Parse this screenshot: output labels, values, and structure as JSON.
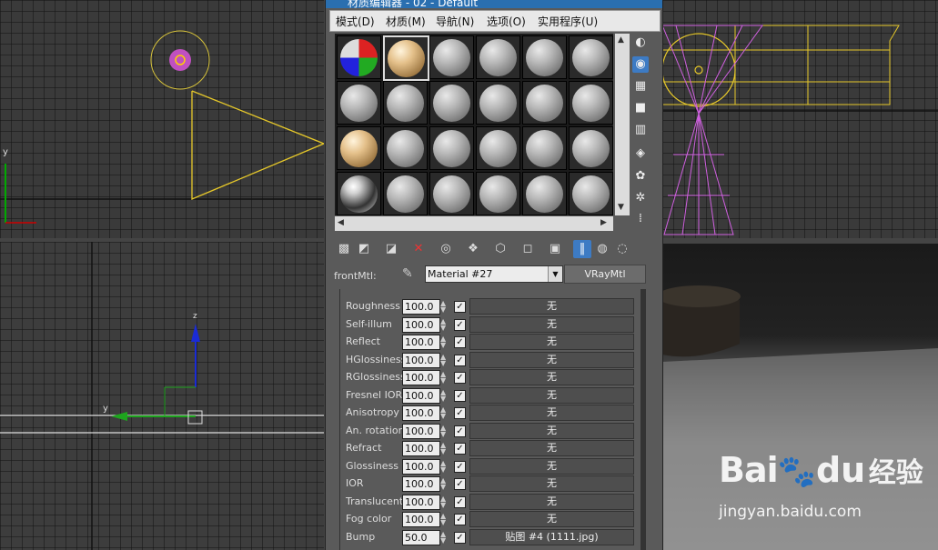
{
  "window": {
    "title": "材质编辑器 - 02 - Default"
  },
  "menu": [
    "模式(D)",
    "材质(M)",
    "导航(N)",
    "选项(O)",
    "实用程序(U)"
  ],
  "viewports": {
    "left_axis": "y",
    "front_axis_z": "z",
    "front_axis_y": "y"
  },
  "slots": {
    "rows": [
      [
        "checker",
        "tan-selected",
        "gray",
        "gray",
        "gray",
        "gray"
      ],
      [
        "gray",
        "gray",
        "gray",
        "gray",
        "gray",
        "gray"
      ],
      [
        "tan",
        "gray",
        "gray",
        "gray",
        "gray",
        "gray"
      ],
      [
        "chrome",
        "gray",
        "gray",
        "gray",
        "gray",
        "gray"
      ]
    ]
  },
  "side_tools": [
    "sample-type-icon",
    "backlight-icon",
    "background-icon",
    "uv-tiling-icon",
    "video-color-icon",
    "make-preview-icon",
    "options-icon",
    "select-by-material-icon",
    "material-navigator-icon"
  ],
  "toolbar": [
    "get-material-icon",
    "put-to-scene-icon",
    "assign-to-selection-icon",
    "reset-map-icon",
    "make-copy-icon",
    "make-unique-icon",
    "put-to-library-icon",
    "material-id-icon",
    "show-shaded-icon",
    "show-end-result-icon",
    "go-to-parent-icon",
    "go-forward-icon"
  ],
  "material": {
    "slot_label": "frontMtl:",
    "name": "Material #27",
    "type": "VRayMtl"
  },
  "params": [
    {
      "label": "Roughness",
      "value": "100.0",
      "map": "无"
    },
    {
      "label": "Self-illum",
      "value": "100.0",
      "map": "无"
    },
    {
      "label": "Reflect",
      "value": "100.0",
      "map": "无"
    },
    {
      "label": "HGlossiness",
      "value": "100.0",
      "map": "无"
    },
    {
      "label": "RGlossiness",
      "value": "100.0",
      "map": "无"
    },
    {
      "label": "Fresnel IOR",
      "value": "100.0",
      "map": "无"
    },
    {
      "label": "Anisotropy",
      "value": "100.0",
      "map": "无"
    },
    {
      "label": "An. rotation",
      "value": "100.0",
      "map": "无"
    },
    {
      "label": "Refract",
      "value": "100.0",
      "map": "无"
    },
    {
      "label": "Glossiness",
      "value": "100.0",
      "map": "无"
    },
    {
      "label": "IOR",
      "value": "100.0",
      "map": "无"
    },
    {
      "label": "Translucent",
      "value": "100.0",
      "map": "无"
    },
    {
      "label": "Fog color",
      "value": "100.0",
      "map": "无"
    },
    {
      "label": "Bump",
      "value": "50.0",
      "map": "贴图 #4 (1111.jpg)"
    }
  ],
  "watermark": {
    "brand": "Bai",
    "brand2": "du",
    "cn": "经验",
    "url": "jingyan.baidu.com"
  }
}
